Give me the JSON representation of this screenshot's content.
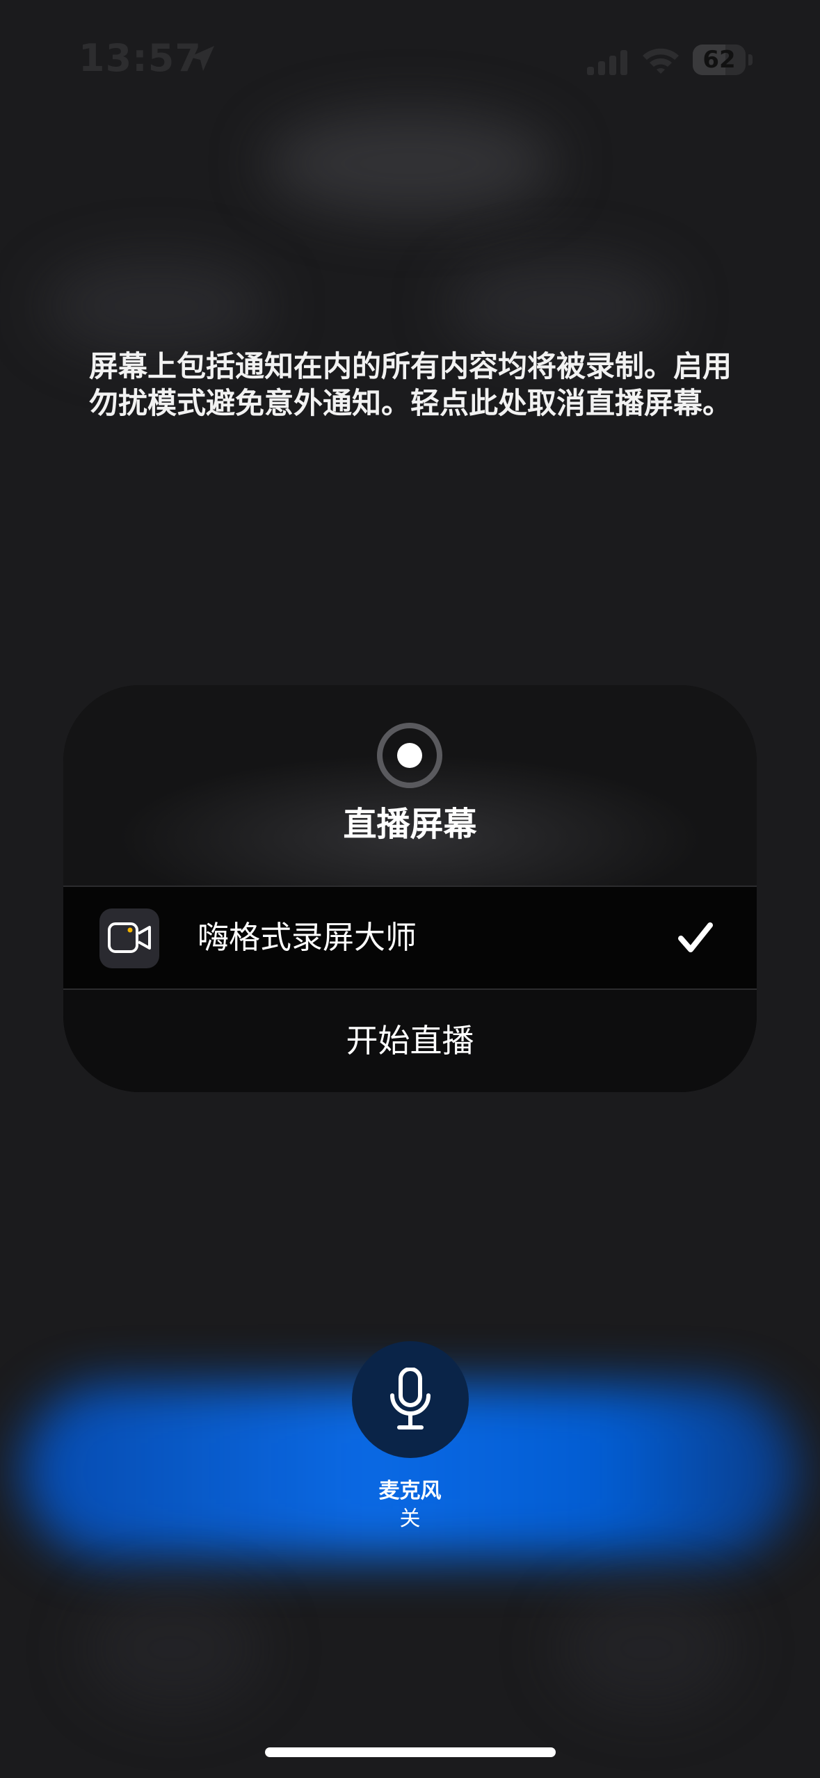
{
  "status_bar": {
    "time": "13:57",
    "battery_level": "62",
    "battery_fraction": 0.62
  },
  "info": {
    "message": "屏幕上包括通知在内的所有内容均将被录制。启用勿扰模式避免意外通知。轻点此处取消直播屏幕。"
  },
  "dialog": {
    "title": "直播屏幕",
    "app": {
      "name": "嗨格式录屏大师",
      "selected": true,
      "icon": "video-camera-icon"
    },
    "start_label": "开始直播"
  },
  "microphone": {
    "label": "麦克风",
    "state": "关"
  },
  "colors": {
    "accent_blue": "#0a6ef0",
    "camera_dot": "#f5b400",
    "mic_button": "#0a2448"
  }
}
